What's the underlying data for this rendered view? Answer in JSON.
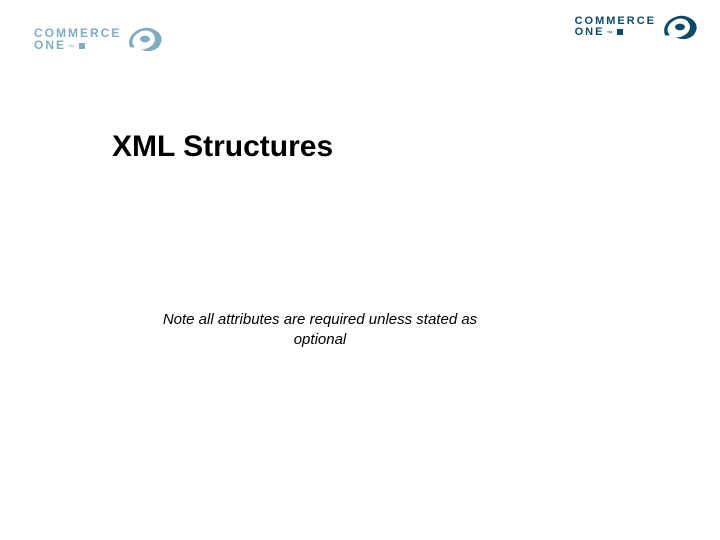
{
  "brand": {
    "line1": "COMMERCE",
    "line2": "ONE",
    "tm": "™"
  },
  "slide": {
    "title": "XML Structures",
    "note": "Note all attributes are required unless stated as optional"
  }
}
